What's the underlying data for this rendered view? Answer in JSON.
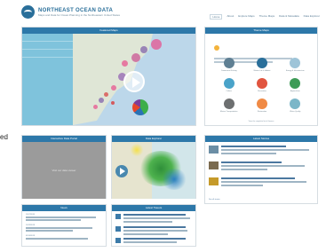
{
  "site": {
    "title": "NORTHEAST OCEAN DATA",
    "subtitle": "Maps and Data for Ocean Planning in the Northeastern United States"
  },
  "nav": [
    "Home",
    "About",
    "Explore Maps",
    "Theme Maps",
    "Data & Metadata",
    "Data Explorer"
  ],
  "side_fragment": "ed",
  "map_panel": {
    "title": "Featured Maps"
  },
  "theme_panel": {
    "title": "Theme Maps",
    "themes": [
      {
        "label": "Commercial Fishing",
        "color": "#5f7f93"
      },
      {
        "label": "Marine Life & Habitat",
        "color": "#2a6f9a"
      },
      {
        "label": "Energy & Infrastructure",
        "color": "#9ec4d8"
      },
      {
        "label": "Culture",
        "color": "#4aa3c9"
      },
      {
        "label": "Recreation",
        "color": "#e1553f"
      },
      {
        "label": "Aquaculture",
        "color": "#3e9b57"
      },
      {
        "label": "Marine Transportation",
        "color": "#6d6f70"
      },
      {
        "label": "Restoration",
        "color": "#f08a45"
      },
      {
        "label": "Water Quality",
        "color": "#7bb6c8"
      }
    ],
    "footer": "View the complete list of themes"
  },
  "explore_panel": {
    "title": "Interactive Data Portal",
    "body": "Visit our data viewer"
  },
  "data_panel": {
    "title": "Data Explorer"
  },
  "stories_panel": {
    "title": "Latest Stories",
    "see_all": "See all stories"
  },
  "news_panel": {
    "title": "News",
    "items": [
      {
        "date": "11/07/2018"
      },
      {
        "date": "10/23/2018"
      },
      {
        "date": "09/14/2018"
      }
    ]
  },
  "tweets_panel": {
    "title": "Latest Tweets"
  }
}
